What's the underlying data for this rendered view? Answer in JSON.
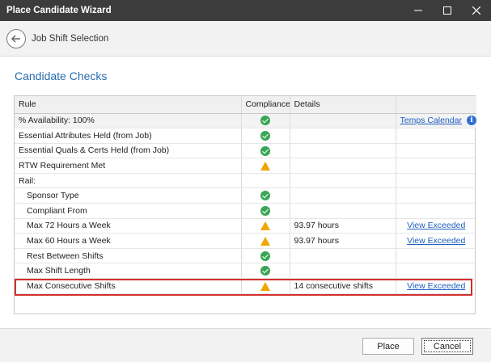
{
  "window": {
    "title": "Place Candidate Wizard"
  },
  "header": {
    "step_title": "Job Shift Selection"
  },
  "section": {
    "title": "Candidate Checks"
  },
  "grid": {
    "columns": [
      "Rule",
      "Compliance",
      "Details",
      ""
    ],
    "rows": [
      {
        "rule": "% Availability: 100%",
        "status": "ok",
        "details": "",
        "action": "Temps Calendar",
        "info": true,
        "indent": false
      },
      {
        "rule": "Essential Attributes Held (from Job)",
        "status": "ok",
        "details": "",
        "action": "",
        "indent": false
      },
      {
        "rule": "Essential Quals & Certs Held (from Job)",
        "status": "ok",
        "details": "",
        "action": "",
        "indent": false
      },
      {
        "rule": "RTW Requirement Met",
        "status": "warning",
        "details": "",
        "action": "",
        "indent": false
      },
      {
        "rule": "Rail:",
        "status": "",
        "details": "",
        "action": "",
        "indent": false
      },
      {
        "rule": "Sponsor Type",
        "status": "ok",
        "details": "",
        "action": "",
        "indent": true
      },
      {
        "rule": "Compliant From",
        "status": "ok",
        "details": "",
        "action": "",
        "indent": true
      },
      {
        "rule": "Max 72 Hours a Week",
        "status": "warning",
        "details": "93.97 hours",
        "action": "View Exceeded",
        "indent": true
      },
      {
        "rule": "Max 60 Hours a Week",
        "status": "warning",
        "details": "93.97 hours",
        "action": "View Exceeded",
        "indent": true
      },
      {
        "rule": "Rest Between Shifts",
        "status": "ok",
        "details": "",
        "action": "",
        "indent": true
      },
      {
        "rule": "Max Shift Length",
        "status": "ok",
        "details": "",
        "action": "",
        "indent": true
      },
      {
        "rule": "Max Consecutive Shifts",
        "status": "warning",
        "details": "14 consecutive shifts",
        "action": "View Exceeded",
        "indent": true
      }
    ]
  },
  "footer": {
    "place_label": "Place",
    "cancel_label": "Cancel"
  },
  "colors": {
    "accent": "#2b6cb0",
    "ok": "#3aa655",
    "warning": "#f0a500",
    "highlight": "#d32f2f"
  }
}
